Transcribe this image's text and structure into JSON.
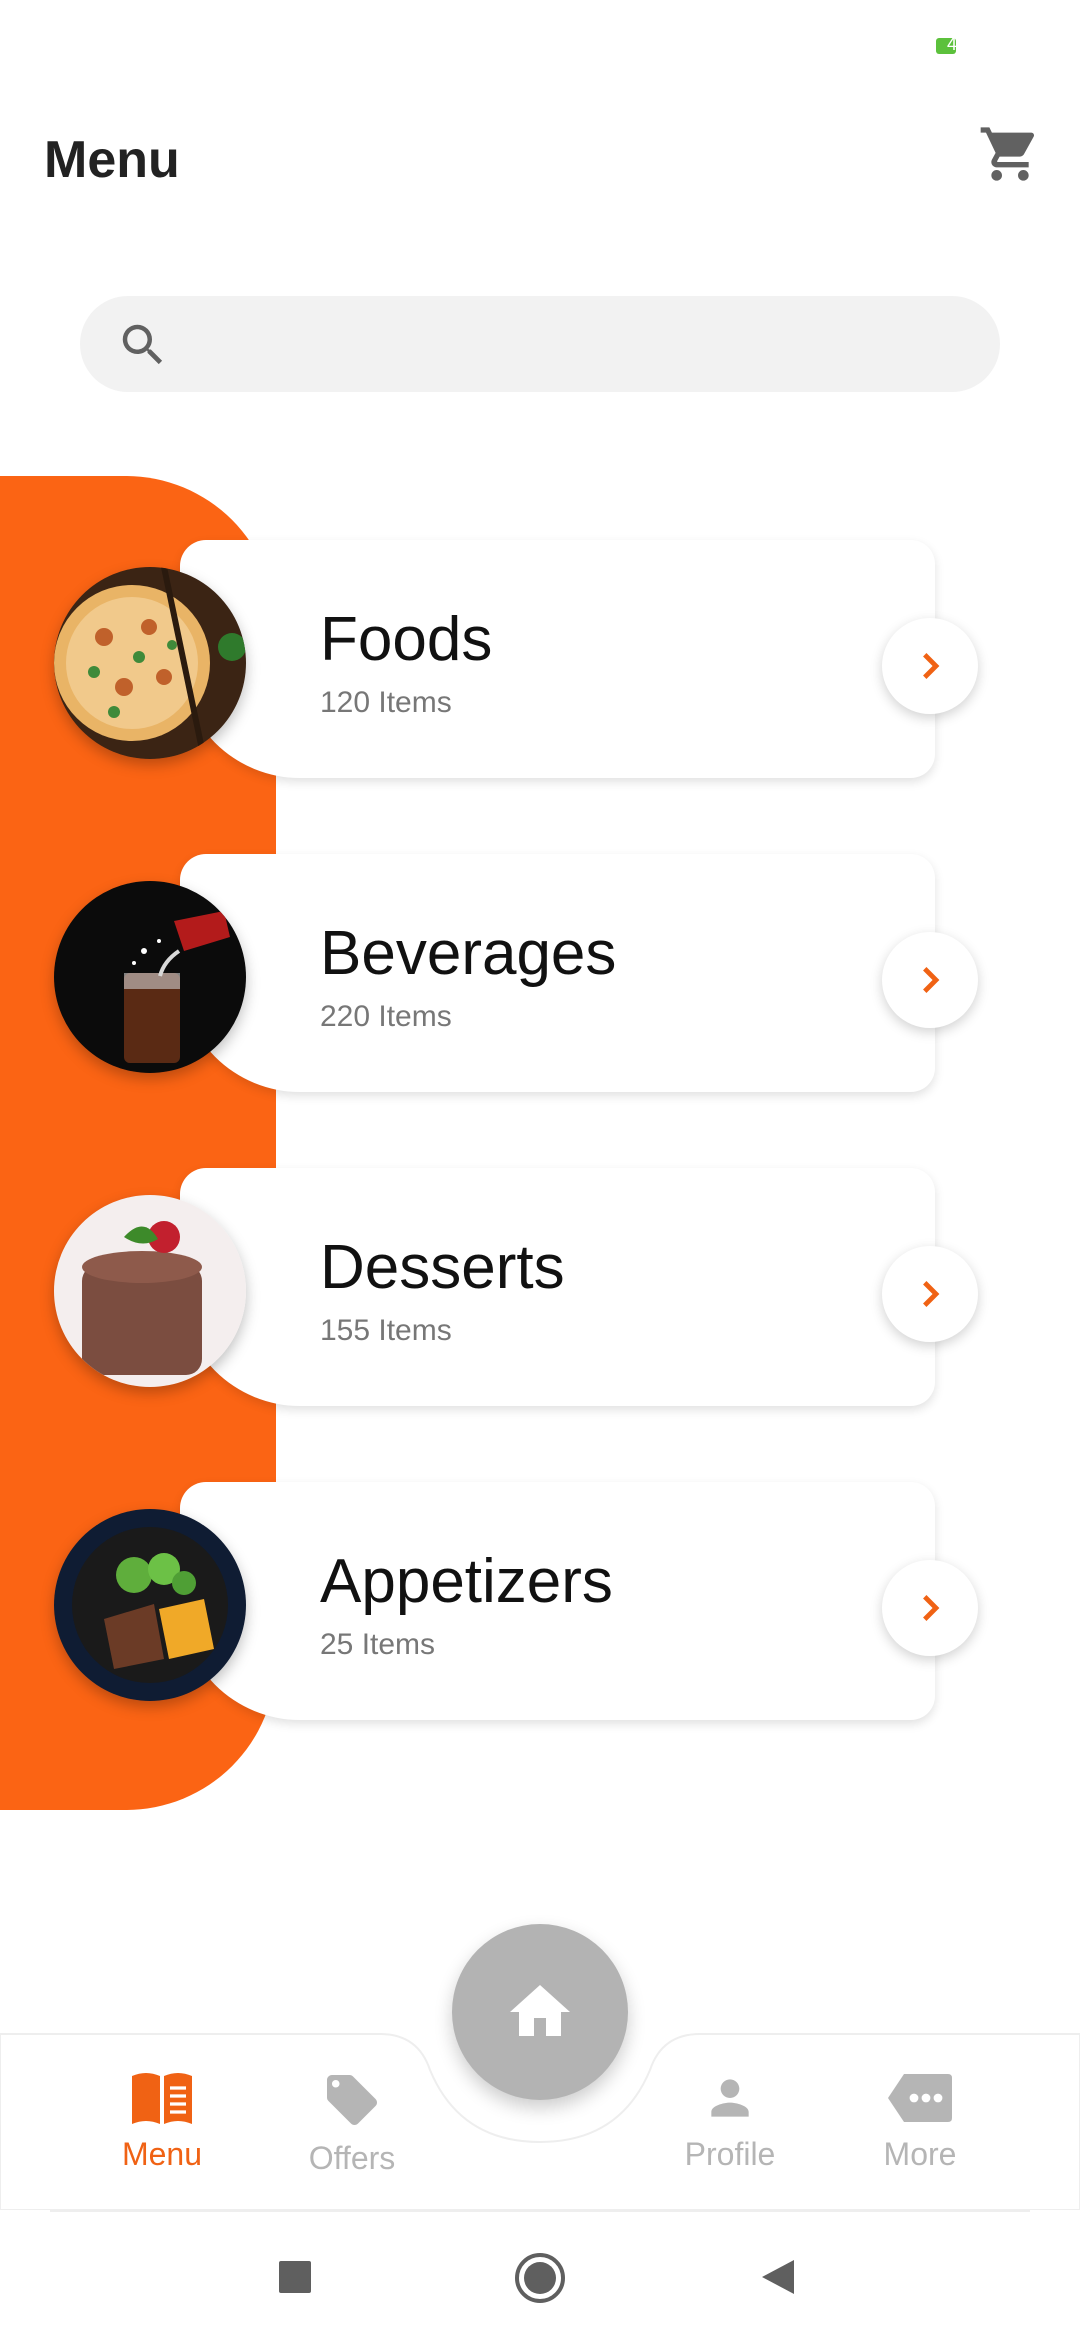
{
  "status_bar": {
    "battery_text": "4"
  },
  "header": {
    "title": "Menu"
  },
  "search": {
    "placeholder": "",
    "value": ""
  },
  "categories": [
    {
      "name": "Foods",
      "count": "120 Items"
    },
    {
      "name": "Beverages",
      "count": "220 Items"
    },
    {
      "name": "Desserts",
      "count": "155 Items"
    },
    {
      "name": "Appetizers",
      "count": "25 Items"
    }
  ],
  "bottom_nav": {
    "items": [
      {
        "label": "Menu",
        "icon": "book-icon",
        "active": true
      },
      {
        "label": "Offers",
        "icon": "tag-icon",
        "active": false
      },
      {
        "label": "Profile",
        "icon": "person-icon",
        "active": false
      },
      {
        "label": "More",
        "icon": "more-icon",
        "active": false
      }
    ],
    "center": {
      "icon": "home-icon"
    }
  },
  "colors": {
    "accent": "#fb6414",
    "active_nav": "#f06214",
    "inactive_nav": "#b5b5b5",
    "fab": "#b3b3b3"
  }
}
